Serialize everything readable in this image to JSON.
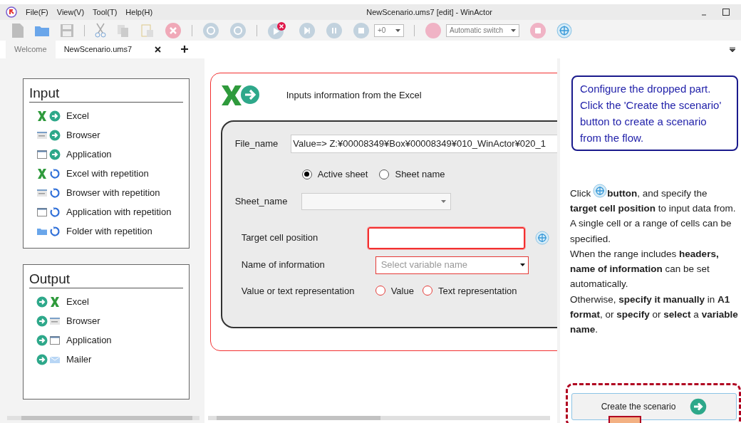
{
  "window": {
    "title": "NewScenario.ums7 [edit] - WinActor",
    "menu": [
      "File(F)",
      "View(V)",
      "Tool(T)",
      "Help(H)"
    ]
  },
  "toolbar": {
    "speed": "+0",
    "mode": "Automatic switch"
  },
  "tabs": [
    {
      "label": "Welcome",
      "selected": false
    },
    {
      "label": "NewScenario.ums7",
      "selected": true
    }
  ],
  "palette": [
    {
      "title": "Input",
      "items": [
        {
          "label": "Excel",
          "kind": "excel",
          "repeat": false
        },
        {
          "label": "Browser",
          "kind": "browser",
          "repeat": false
        },
        {
          "label": "Application",
          "kind": "application",
          "repeat": false
        },
        {
          "label": "Excel with repetition",
          "kind": "excel",
          "repeat": true
        },
        {
          "label": "Browser with repetition",
          "kind": "browser",
          "repeat": true
        },
        {
          "label": "Application with repetition",
          "kind": "application",
          "repeat": true
        },
        {
          "label": "Folder with repetition",
          "kind": "folder",
          "repeat": true
        }
      ]
    },
    {
      "title": "Output",
      "items": [
        {
          "label": "Excel",
          "kind": "excel",
          "repeat": false
        },
        {
          "label": "Browser",
          "kind": "browser",
          "repeat": false
        },
        {
          "label": "Application",
          "kind": "application",
          "repeat": false
        },
        {
          "label": "Mailer",
          "kind": "mailer",
          "repeat": false
        }
      ]
    }
  ],
  "form": {
    "heading": "Inputs information from the Excel",
    "file_name": {
      "label": "File_name",
      "value": "Value=>  Z:¥00008349¥Box¥00008349¥010_WinActor¥020_1"
    },
    "sheet_mode": [
      {
        "label": "Active sheet",
        "selected": true
      },
      {
        "label": "Sheet name",
        "selected": false
      }
    ],
    "sheet_name": {
      "label": "Sheet_name"
    },
    "target_cell": {
      "label": "Target cell position"
    },
    "info_name": {
      "label": "Name of information",
      "placeholder": "Select variable name"
    },
    "representation": {
      "label": "Value or text representation",
      "options": [
        {
          "label": "Value",
          "selected": false
        },
        {
          "label": "Text representation",
          "selected": false
        }
      ]
    }
  },
  "help": {
    "callout": "Configure the dropped part. Click the 'Create the scenario' button to create a scenario from the flow.",
    "lead": "Click",
    "lead_rest": "**button**, and specify the",
    "paragraphs": [
      "**target cell position** to input data from.",
      "A single cell or a range of cells can be specified.",
      "When the range includes **headers, name of information** can be set automatically.",
      "Otherwise, **specify it manually** in **A1 format**, or **specify** or **select** a **variable name**."
    ],
    "create_button": "Create the scenario"
  }
}
